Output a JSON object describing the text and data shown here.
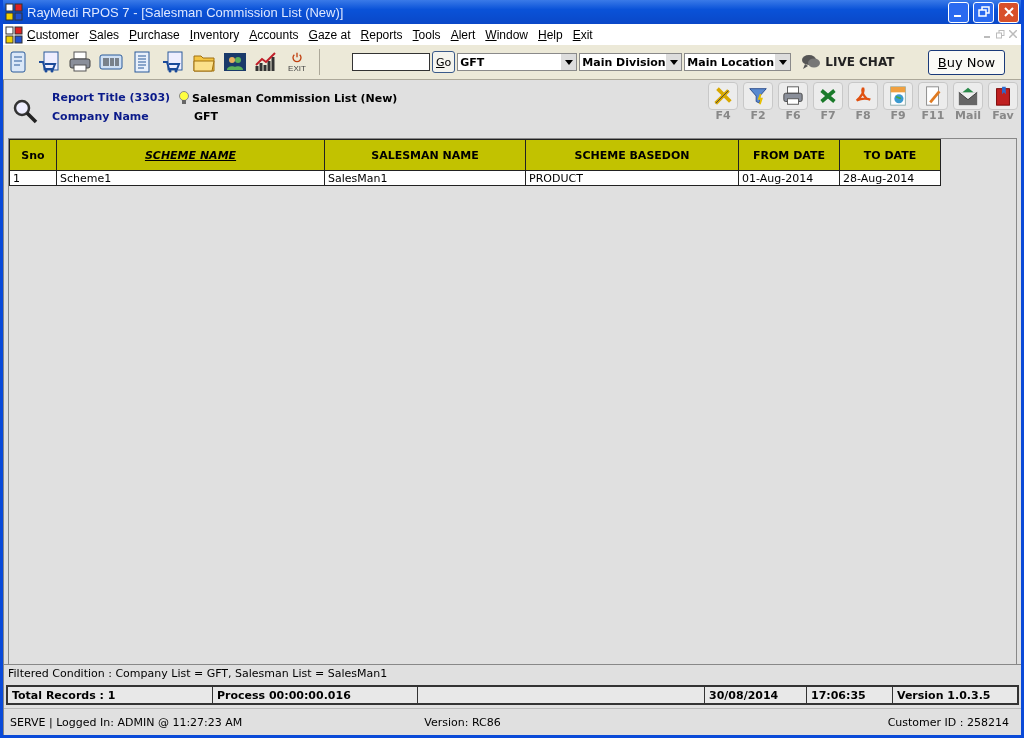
{
  "window": {
    "title": "RayMedi RPOS 7 - [Salesman Commission List (New)]"
  },
  "menu": [
    "Customer",
    "Sales",
    "Purchase",
    "Inventory",
    "Accounts",
    "Gaze at",
    "Reports",
    "Tools",
    "Alert",
    "Window",
    "Help",
    "Exit"
  ],
  "toolbar": {
    "tools": [
      {
        "kind": "scroll"
      },
      {
        "kind": "cart-doc"
      },
      {
        "kind": "printer"
      },
      {
        "kind": "barcode"
      },
      {
        "kind": "document"
      },
      {
        "kind": "cart-doc"
      },
      {
        "kind": "folder"
      },
      {
        "kind": "people"
      },
      {
        "kind": "chart"
      },
      {
        "kind": "exit",
        "label": "EXIT"
      }
    ],
    "go": "Go",
    "company": "GFT",
    "division": "Main Division",
    "location": "Main Location",
    "live_chat": "LIVE CHAT",
    "buy_now": "Buy Now"
  },
  "report": {
    "title_label": "Report Title (3303)",
    "title": "Salesman Commission List (New)",
    "company_label": "Company Name",
    "company": "GFT"
  },
  "actions": [
    {
      "kind": "tools",
      "key": "F4"
    },
    {
      "kind": "filter",
      "key": "F2"
    },
    {
      "kind": "printer",
      "key": "F6"
    },
    {
      "kind": "excel",
      "key": "F7"
    },
    {
      "kind": "pdf",
      "key": "F8"
    },
    {
      "kind": "html",
      "key": "F9"
    },
    {
      "kind": "edit",
      "key": "F11"
    },
    {
      "kind": "mail",
      "key": "Mail"
    },
    {
      "kind": "book",
      "key": "Fav"
    }
  ],
  "table": {
    "columns": [
      {
        "label": "Sno",
        "sorted": false
      },
      {
        "label": "SCHEME NAME",
        "sorted": true
      },
      {
        "label": "SALESMAN NAME",
        "sorted": false
      },
      {
        "label": "SCHEME BASEDON",
        "sorted": false
      },
      {
        "label": "FROM DATE",
        "sorted": false
      },
      {
        "label": "TO DATE",
        "sorted": false
      }
    ],
    "rows": [
      [
        "1",
        "Scheme1",
        "SalesMan1",
        "PRODUCT",
        "01-Aug-2014",
        "28-Aug-2014"
      ]
    ]
  },
  "filter": "Filtered Condition :  Company List = GFT, Salesman List = SalesMan1",
  "status_bar": [
    "Total Records : 1",
    "Process 00:00:00.016",
    "30/08/2014",
    "17:06:35",
    "Version 1.0.3.5"
  ],
  "footer": {
    "left": "SERVE |  Logged In: ADMIN  @ 11:27:23 AM",
    "center": "Version: RC86",
    "right": "Customer ID : 258214"
  }
}
